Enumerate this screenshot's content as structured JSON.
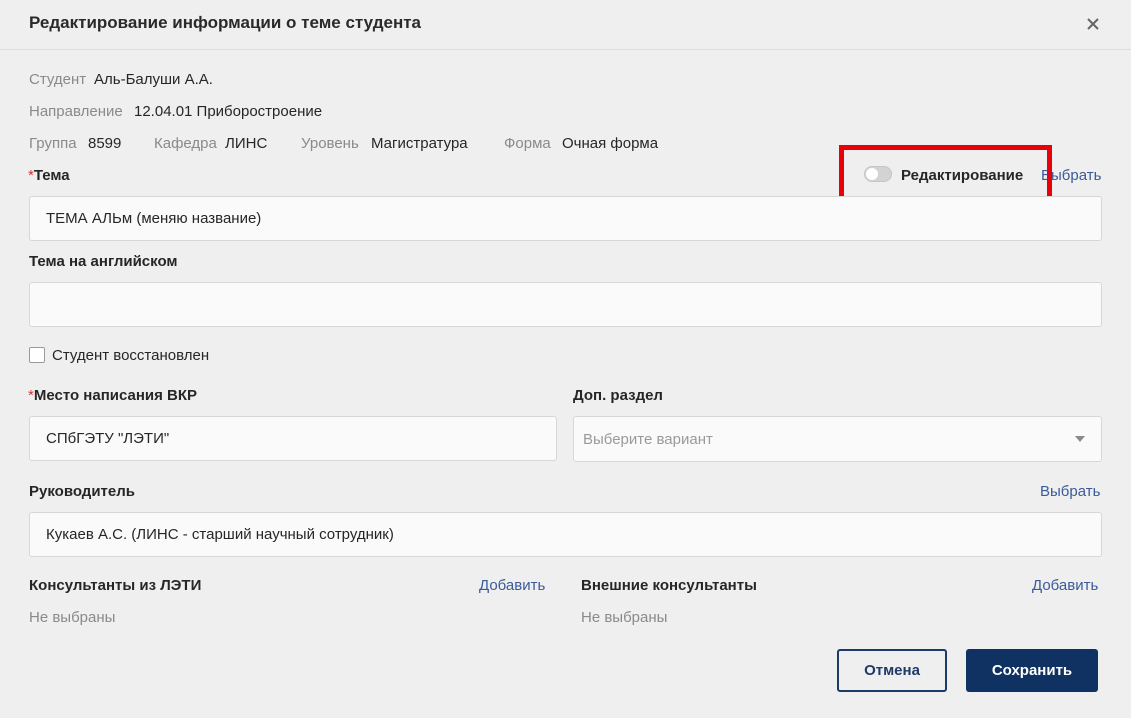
{
  "dialog": {
    "title": "Редактирование информации о теме студента"
  },
  "info": {
    "student_label": "Студент",
    "student_value": "Аль-Балуши А.А.",
    "direction_label": "Направление",
    "direction_value": "12.04.01 Приборостроение",
    "group_label": "Группа",
    "group_value": "8599",
    "department_label": "Кафедра",
    "department_value": "ЛИНС",
    "level_label": "Уровень",
    "level_value": "Магистратура",
    "form_label": "Форма",
    "form_value": "Очная форма"
  },
  "topic": {
    "required_mark": "*",
    "label": "Тема",
    "value": "ТЕМА АЛЬм (меняю название)",
    "editing_label": "Редактирование",
    "select_link": "Выбрать"
  },
  "topic_en": {
    "label": "Тема на английском",
    "value": ""
  },
  "restored": {
    "label": "Студент восстановлен",
    "checked": false
  },
  "place": {
    "required_mark": "*",
    "label": "Место написания ВКР",
    "value": "СПбГЭТУ \"ЛЭТИ\""
  },
  "extra_section": {
    "label": "Доп. раздел",
    "placeholder": "Выберите вариант"
  },
  "supervisor": {
    "label": "Руководитель",
    "select_link": "Выбрать",
    "value": "Кукаев А.С. (ЛИНС - старший научный сотрудник)"
  },
  "consultants": {
    "leti_label": "Консультанты из ЛЭТИ",
    "leti_add": "Добавить",
    "leti_empty": "Не выбраны",
    "external_label": "Внешние консультанты",
    "external_add": "Добавить",
    "external_empty": "Не выбраны"
  },
  "buttons": {
    "cancel": "Отмена",
    "save": "Сохранить"
  },
  "colors": {
    "primary": "#0f3263",
    "link": "#3b5a9a",
    "required": "#d9322b",
    "highlight": "#e8000b"
  }
}
